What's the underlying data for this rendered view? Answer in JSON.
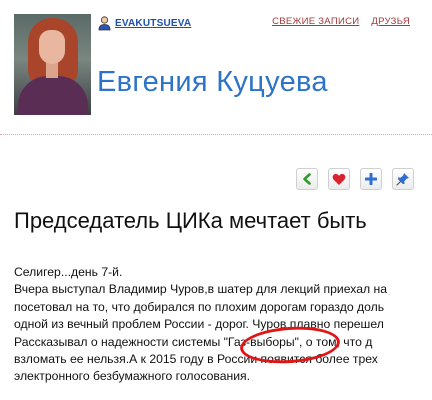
{
  "header": {
    "username": "EVAKUTSUEVA",
    "nav": [
      "СВЕЖИЕ ЗАПИСИ",
      "ДРУЗЬЯ"
    ],
    "blog_title": "Евгения Куцуева"
  },
  "actions": [
    {
      "icon": "back-arrow-icon",
      "color": "#2e9b2e"
    },
    {
      "icon": "heart-icon",
      "color": "#d9232e"
    },
    {
      "icon": "plus-icon",
      "color": "#2f6fcf"
    },
    {
      "icon": "pin-icon",
      "color": "#2f6fcf"
    }
  ],
  "post": {
    "title": "Председатель ЦИКа мечтает быть",
    "lines": [
      "Селигер...день 7-й.",
      "Вчера выступал Владимир Чуров,в шатер для лекций приехал на",
      "посетовал на то, что добирался по плохим дорогам гораздо доль",
      "одной из вечный проблем России - дорог. Чуров плавно перешел",
      " Рассказывал о надежности системы \"Газ-выборы\", о том, что д",
      "взломать ее нельзя.А к 2015 году в России появится более трех",
      "электронного безбумажного голосования."
    ]
  },
  "annotation_color": "#e01616"
}
